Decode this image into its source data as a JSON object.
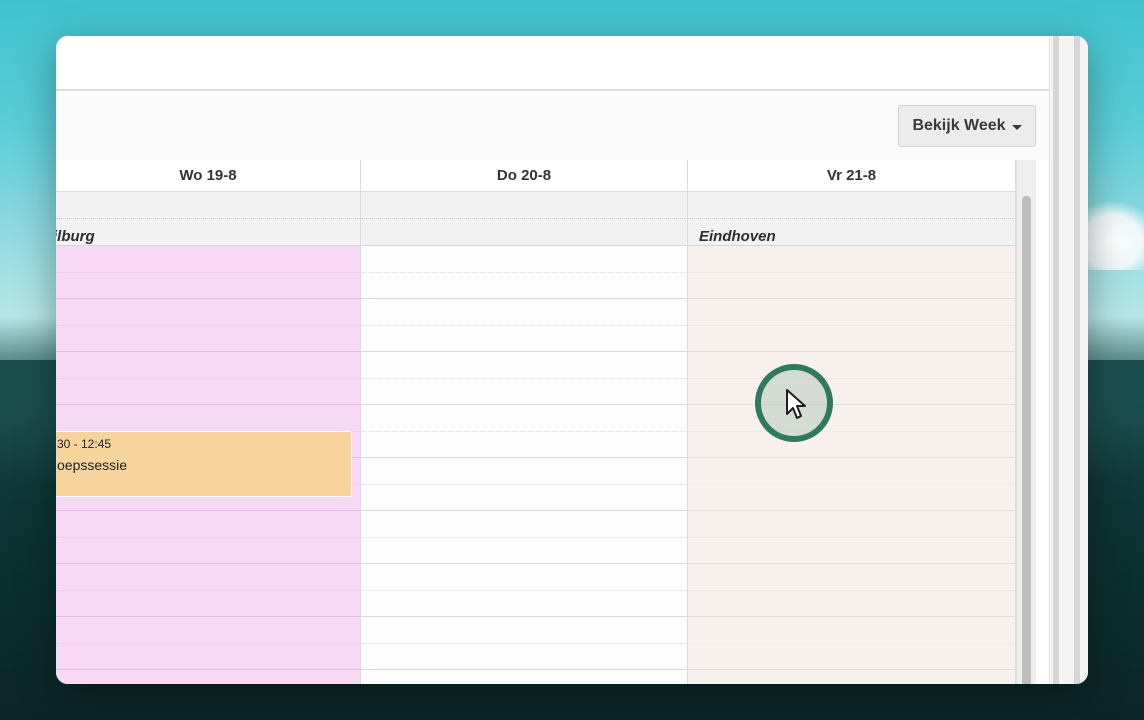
{
  "toolbar": {
    "view_button_label": "Bekijk Week"
  },
  "calendar": {
    "days": [
      {
        "label": "Wo 19-8",
        "location": "ilburg",
        "style": "pink"
      },
      {
        "label": "Do 20-8",
        "location": "",
        "style": "plain"
      },
      {
        "label": "Vr 21-8",
        "location": "Eindhoven",
        "style": "beige"
      }
    ],
    "event": {
      "time": "30 - 12:45",
      "title": "oepssessie",
      "color": "#f6d49b"
    }
  },
  "colors": {
    "wednesday_bg": "#f7d9f5",
    "friday_bg": "#f8f1ee",
    "cursor_ring": "#2f7a5f"
  },
  "icons": {
    "view_button": "caret-down-icon",
    "cursor": "mouse-pointer-icon"
  }
}
